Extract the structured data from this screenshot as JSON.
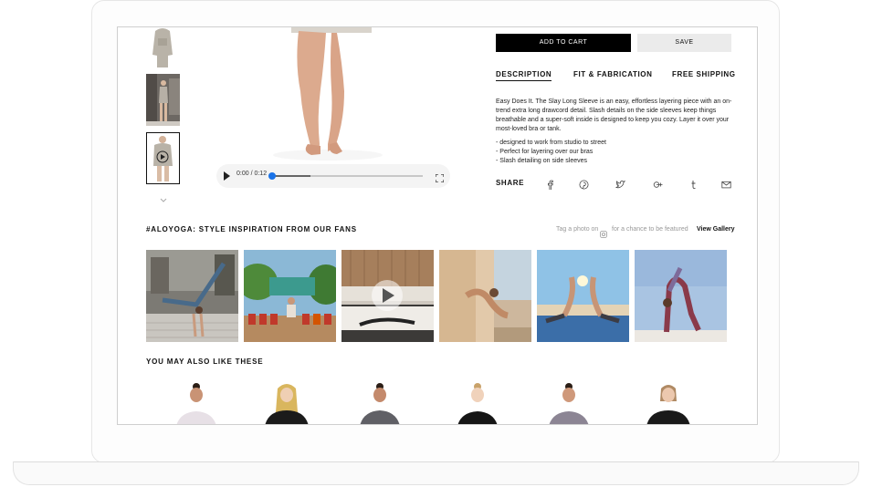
{
  "video": {
    "time": "0:00 / 0:12",
    "progress": 0.0
  },
  "buttons": {
    "add_to_cart": "ADD TO CART",
    "save": "SAVE"
  },
  "tabs": [
    {
      "label": "DESCRIPTION",
      "active": true
    },
    {
      "label": "FIT & FABRICATION",
      "active": false
    },
    {
      "label": "FREE SHIPPING",
      "active": false
    }
  ],
  "description": "Easy Does It. The Slay Long Sleeve is an easy, effortless layering piece with an on-trend extra long drawcord detail. Slash details on the side sleeves keep things breathable and a super-soft inside is designed to keep you cozy. Layer it over your most-loved bra or tank.",
  "bullets": [
    "- designed to work from studio to street",
    "- Perfect for layering over our bras",
    "- Slash detailing on side sleeves"
  ],
  "share": {
    "label": "SHARE",
    "icons": [
      "facebook-icon",
      "pinterest-icon",
      "twitter-icon",
      "google-plus-icon",
      "tumblr-icon",
      "email-icon"
    ]
  },
  "inspiration": {
    "title": "#ALOYOGA: STYLE INSPIRATION FROM OUR FANS",
    "tag_prefix": "Tag a photo on",
    "tag_suffix": "for a chance to be featured",
    "view_gallery": "View Gallery"
  },
  "recommendations": {
    "title": "YOU MAY ALSO LIKE THESE"
  },
  "colors": {
    "accent": "#000000",
    "save_bg": "#ebebeb",
    "video_dot": "#1a73e8"
  }
}
